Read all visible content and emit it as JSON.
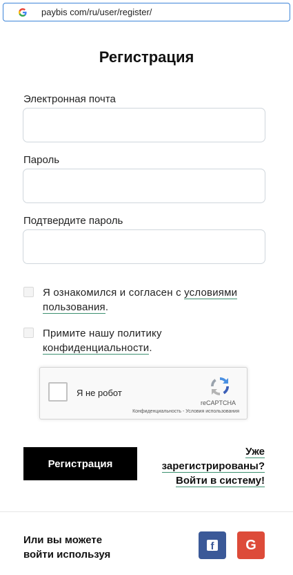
{
  "browser": {
    "url": "paybis com/ru/user/register/"
  },
  "page": {
    "title": "Регистрация"
  },
  "form": {
    "email_label": "Электронная почта",
    "email_value": "",
    "password_label": "Пароль",
    "password_value": "",
    "confirm_label": "Подтвердите пароль",
    "confirm_value": "",
    "terms_text": "Я ознакомился и согласен с ",
    "terms_link": "условиями пользования",
    "terms_end": ".",
    "terms_checked": false,
    "privacy_text": "Примите нашу политику ",
    "privacy_link": "конфиденциальности",
    "privacy_end": ".",
    "privacy_checked": false
  },
  "recaptcha": {
    "label": "Я не робот",
    "brand": "reCAPTCHA",
    "terms": "Конфиденциальность - Условия использования"
  },
  "actions": {
    "register_label": "Регистрация",
    "login_line1": "Уже",
    "login_line2": "зарегистрированы?",
    "login_line3": "Войти в систему!"
  },
  "social": {
    "text_line1": "Или вы можете",
    "text_line2": "войти используя",
    "facebook_glyph": "f",
    "google_glyph": "G",
    "facebook_color": "#3b5998",
    "google_color": "#dd4b39"
  }
}
